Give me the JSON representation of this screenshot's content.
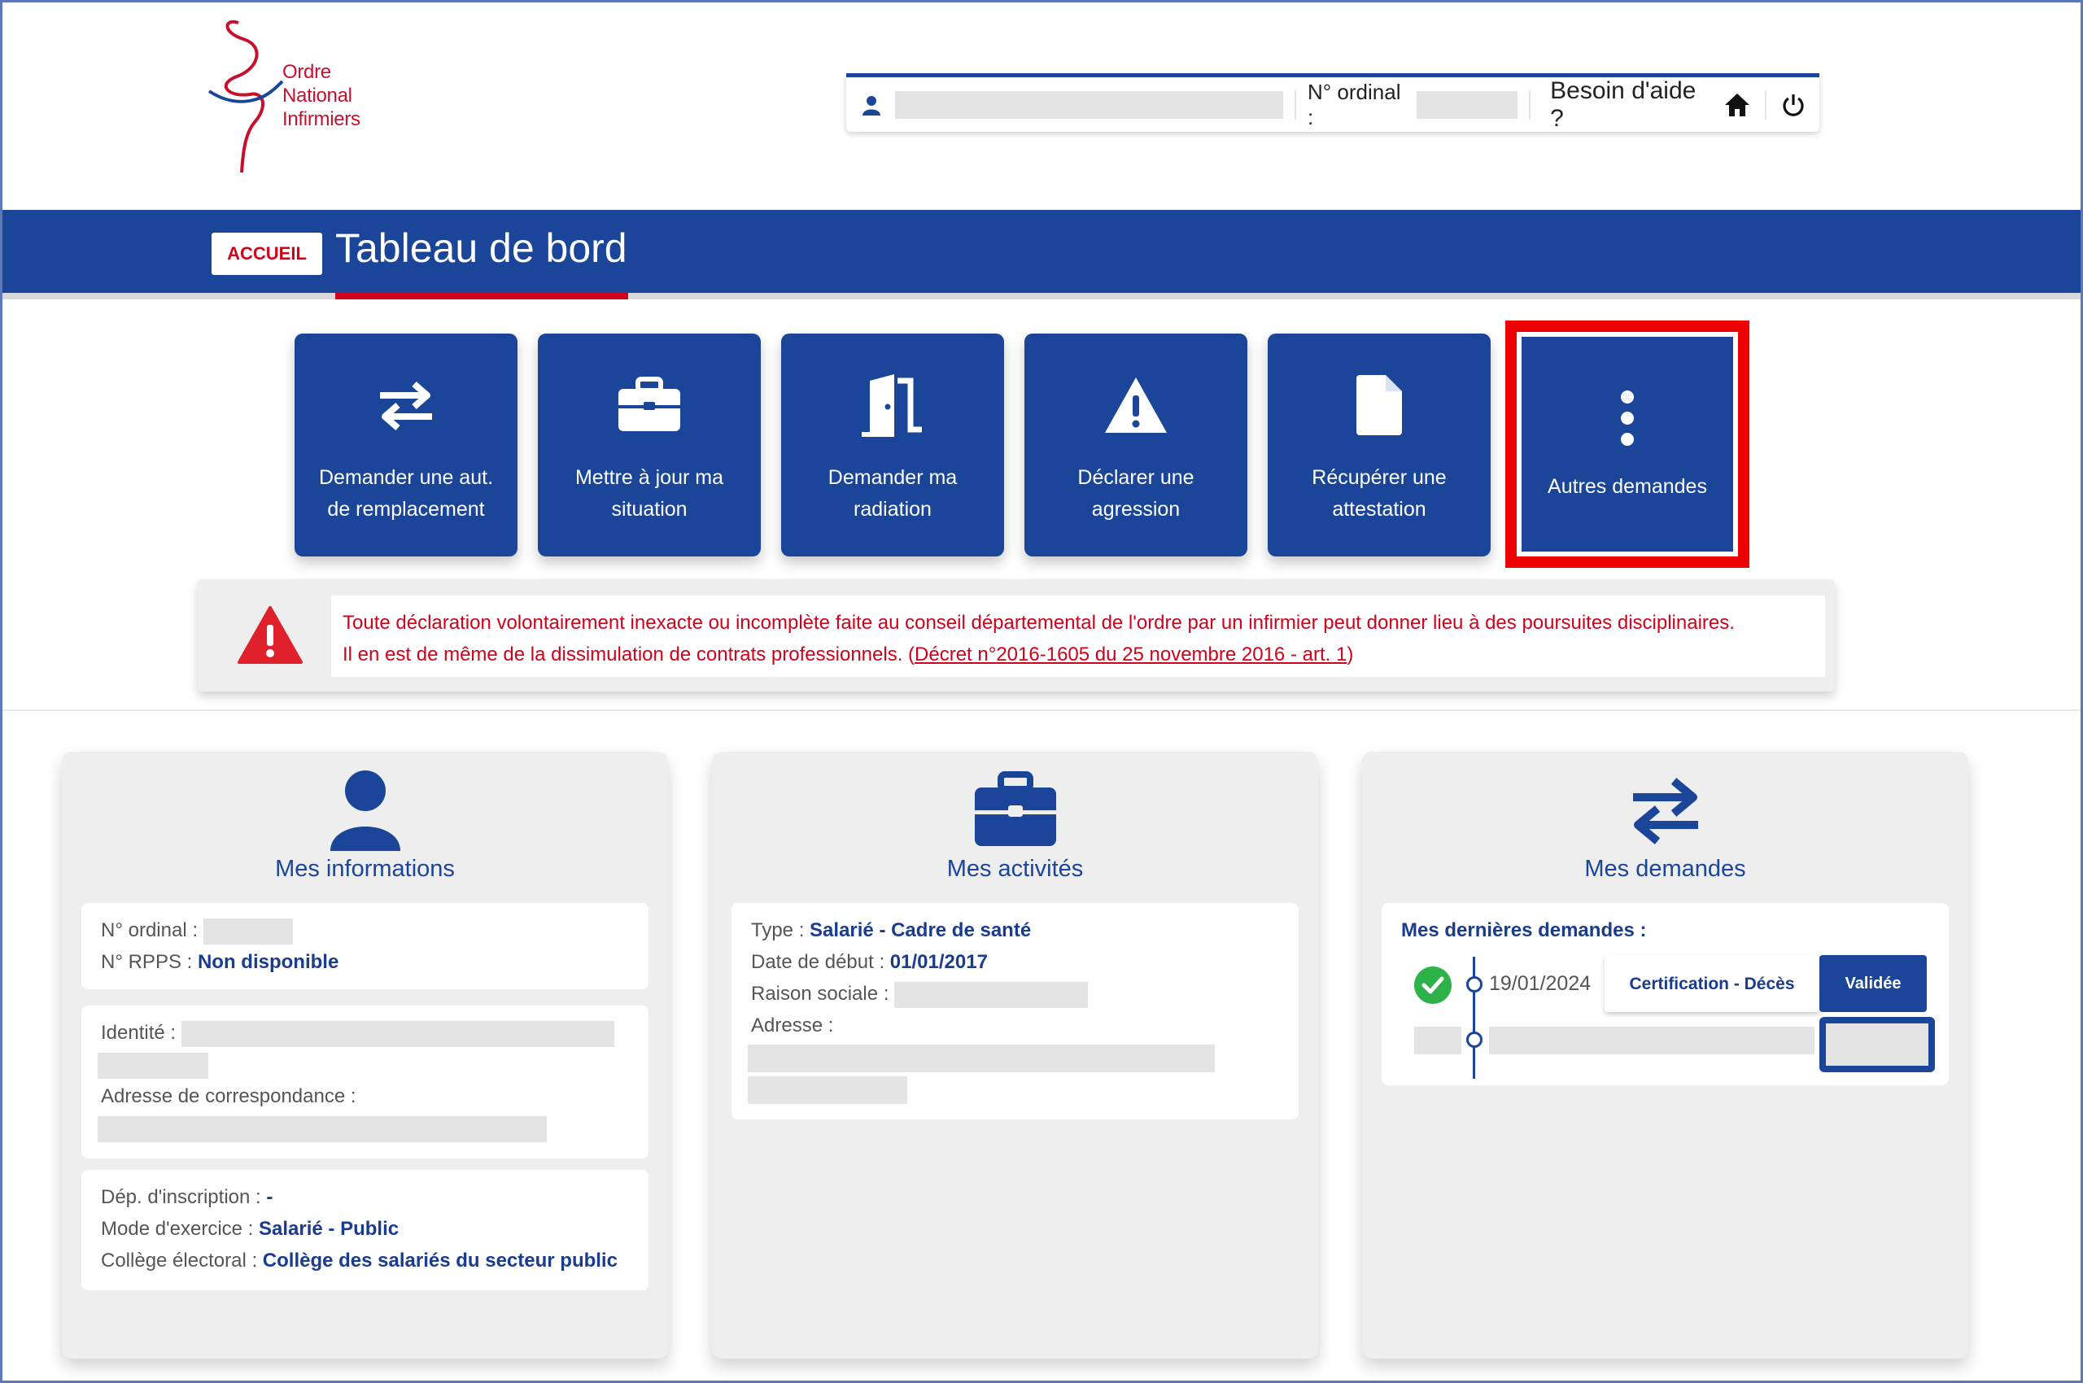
{
  "logo": {
    "line1": "Ordre",
    "line2": "National",
    "line3": "Infirmiers"
  },
  "userbar": {
    "ordinal_label": "N° ordinal :",
    "help_label": "Besoin d'aide ?",
    "icons": [
      "user-icon",
      "home-icon",
      "power-icon"
    ]
  },
  "header": {
    "badge": "ACCUEIL",
    "title": "Tableau de bord"
  },
  "tiles": [
    {
      "label_1": "Demander une aut.",
      "label_2": "de remplacement",
      "icon": "arrows-exchange-icon"
    },
    {
      "label_1": "Mettre à jour ma",
      "label_2": "situation",
      "icon": "briefcase-icon"
    },
    {
      "label_1": "Demander ma",
      "label_2": "radiation",
      "icon": "door-exit-icon"
    },
    {
      "label_1": "Déclarer une",
      "label_2": "agression",
      "icon": "warning-icon"
    },
    {
      "label_1": "Récupérer une",
      "label_2": "attestation",
      "icon": "document-icon"
    },
    {
      "label_1": "Autres demandes",
      "icon": "more-vertical-icon"
    }
  ],
  "warning": {
    "line1": "Toute déclaration volontairement inexacte ou incomplète faite au conseil départemental de l'ordre par un infirmier peut donner lieu à des poursuites disciplinaires.",
    "line2_prefix": "Il en est de même de la dissimulation de contrats professionnels. (",
    "link": "Décret n°2016-1605 du 25 novembre 2016 - art. 1",
    "line2_suffix": ")"
  },
  "cards": {
    "infos": {
      "title": "Mes informations",
      "ordinal_label": "N° ordinal :",
      "rpps_label": "N° RPPS :",
      "rpps_value": "Non disponible",
      "identity_label": "Identité :",
      "address_label": "Adresse de correspondance :",
      "dep_label": "Dép. d'inscription :",
      "dep_value": "-",
      "mode_label": "Mode d'exercice :",
      "mode_value": "Salarié - Public",
      "college_label": "Collège électoral :",
      "college_value": "Collège des salariés du secteur public"
    },
    "activites": {
      "title": "Mes activités",
      "type_label": "Type :",
      "type_value": "Salarié - Cadre de santé",
      "date_label": "Date de début :",
      "date_value": "01/01/2017",
      "raison_label": "Raison sociale :",
      "adresse_label": "Adresse :"
    },
    "demandes": {
      "title": "Mes demandes",
      "heading": "Mes dernières demandes :",
      "items": [
        {
          "date": "19/01/2024",
          "type": "Certification - Décès",
          "status": "Validée"
        }
      ]
    }
  },
  "colors": {
    "primary": "#1a4598",
    "accent_red": "#d0021b",
    "highlight": "#ee0000",
    "success": "#2db24a"
  }
}
